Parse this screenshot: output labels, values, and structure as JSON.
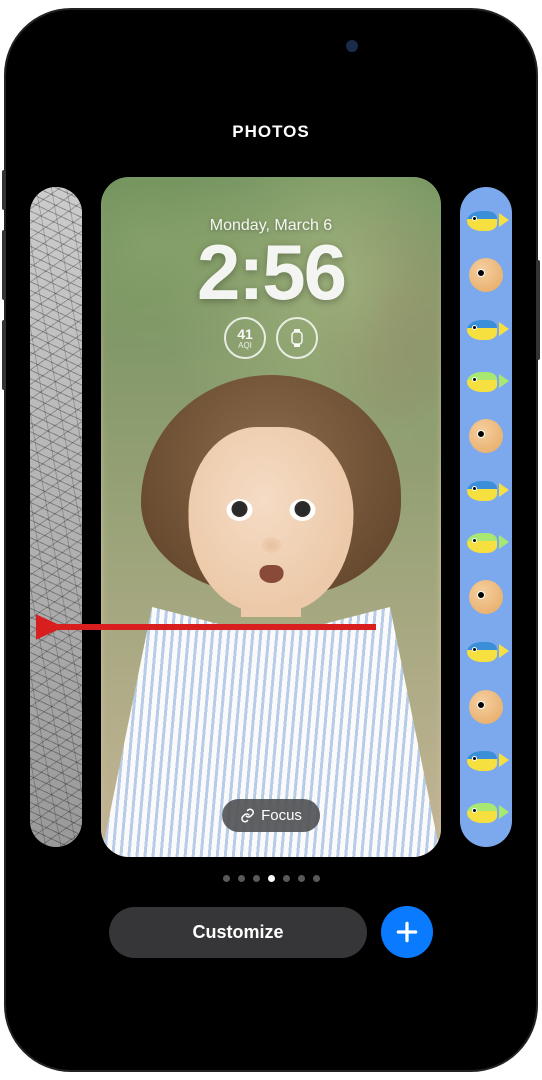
{
  "header": {
    "title": "PHOTOS"
  },
  "lockscreen": {
    "date": "Monday, March 6",
    "time": "2:56",
    "aqi_value": "41",
    "aqi_label": "AQI",
    "focus_label": "Focus"
  },
  "buttons": {
    "customize": "Customize",
    "add": "+"
  },
  "pagination": {
    "total": 7,
    "active_index": 3
  },
  "colors": {
    "accent_blue": "#0a7bff",
    "arrow_red": "#d81e1e"
  }
}
